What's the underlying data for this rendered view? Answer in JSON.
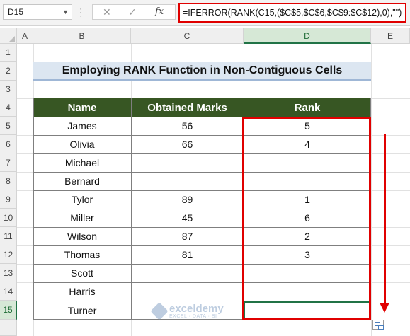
{
  "formula_bar": {
    "name_box": "D15",
    "cancel_icon": "✕",
    "enter_icon": "✓",
    "fx_label": "fx",
    "formula": "=IFERROR(RANK(C15,($C$5,$C$6,$C$9:$C$12),0),\"\")"
  },
  "columns": [
    "A",
    "B",
    "C",
    "D",
    "E"
  ],
  "selected_column": "D",
  "rows": [
    "1",
    "2",
    "3",
    "4",
    "5",
    "6",
    "7",
    "8",
    "9",
    "10",
    "11",
    "12",
    "13",
    "14",
    "15"
  ],
  "selected_row": "15",
  "title": "Employing RANK Function in Non-Contiguous Cells",
  "table": {
    "headers": [
      "Name",
      "Obtained Marks",
      "Rank"
    ],
    "rows": [
      {
        "name": "James",
        "marks": "56",
        "rank": "5"
      },
      {
        "name": "Olivia",
        "marks": "66",
        "rank": "4"
      },
      {
        "name": "Michael",
        "marks": "",
        "rank": ""
      },
      {
        "name": "Bernard",
        "marks": "",
        "rank": ""
      },
      {
        "name": "Tylor",
        "marks": "89",
        "rank": "1"
      },
      {
        "name": "Miller",
        "marks": "45",
        "rank": "6"
      },
      {
        "name": "Wilson",
        "marks": "87",
        "rank": "2"
      },
      {
        "name": "Thomas",
        "marks": "81",
        "rank": "3"
      },
      {
        "name": "Scott",
        "marks": "",
        "rank": ""
      },
      {
        "name": "Harris",
        "marks": "",
        "rank": ""
      },
      {
        "name": "Turner",
        "marks": "",
        "rank": ""
      }
    ]
  },
  "watermark": {
    "name": "exceldemy",
    "tagline": "EXCEL · DATA · BI"
  },
  "colors": {
    "header_bg": "#375623",
    "title_bg": "#dce6f1",
    "highlight": "#e00000",
    "selection": "#217346"
  }
}
